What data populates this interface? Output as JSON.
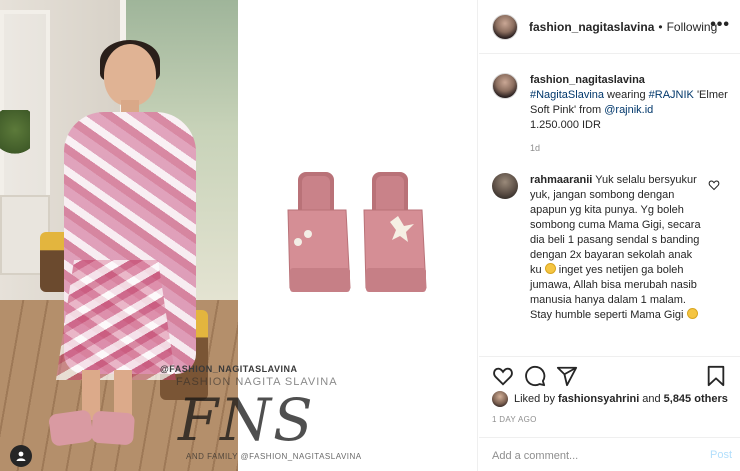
{
  "post": {
    "author": "fashion_nagitaslavina",
    "follow_status": "Following",
    "more_label": "•••",
    "watermark": {
      "handle": "@FASHION_NAGITASLAVINA",
      "subtitle": "FASHION NAGITA SLAVINA",
      "logo": "FNS",
      "footer": "AND FAMILY  @FASHION_NAGITASLAVINA"
    }
  },
  "caption": {
    "author": "fashion_nagitaslavina",
    "mention1": "#NagitaSlavina",
    "text1": " wearing ",
    "hashtag": "#RAJNIK",
    "text2": " 'Elmer Soft Pink' from ",
    "mention2": "@rajnik.id",
    "price": "1.250.000 IDR",
    "time": "1d"
  },
  "comment": {
    "author": "rahmaaranii",
    "text_a": " Yuk selalu bersyukur yuk, jangan sombong dengan apapun yg kita punya. Yg boleh sombong cuma Mama Gigi, secara dia beli 1 pasang sendal s banding dengan 2x bayaran sekolah anak ku ",
    "text_b": " inget yes netijen ga boleh jumawa, Allah bisa merubah nasib manusia hanya dalam 1 malam. Stay humble seperti Mama Gigi ",
    "icons": [
      "smile-emoji",
      "blush-emoji"
    ]
  },
  "actions": {
    "icons": [
      "heart-icon",
      "comment-icon",
      "share-icon",
      "bookmark-icon"
    ]
  },
  "likes": {
    "prefix": "Liked by",
    "user": "fashionsyahrini",
    "joiner": "and",
    "others": "5,845 others"
  },
  "post_age": "1 DAY AGO",
  "add_comment": {
    "placeholder": "Add a comment...",
    "post_label": "Post"
  }
}
